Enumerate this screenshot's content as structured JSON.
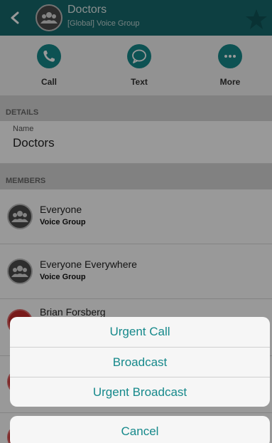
{
  "header": {
    "title": "Doctors",
    "subtitle": "[Global] Voice Group",
    "back_icon": "chevron-left-icon",
    "favorite_icon": "star-icon"
  },
  "actions": [
    {
      "label": "Call",
      "icon": "phone-icon"
    },
    {
      "label": "Text",
      "icon": "chat-bubble-icon"
    },
    {
      "label": "More",
      "icon": "ellipsis-icon"
    }
  ],
  "details": {
    "section_label": "DETAILS",
    "name_label": "Name",
    "name_value": "Doctors"
  },
  "members": {
    "section_label": "MEMBERS",
    "items": [
      {
        "name": "Everyone",
        "type": "Voice Group",
        "icon": "group-icon"
      },
      {
        "name": "Everyone Everywhere",
        "type": "Voice Group",
        "icon": "group-icon"
      },
      {
        "name": "Brian Forsberg",
        "icon": "person-avatar"
      }
    ]
  },
  "action_sheet": {
    "options": [
      "Urgent Call",
      "Broadcast",
      "Urgent Broadcast"
    ],
    "cancel_label": "Cancel"
  },
  "colors": {
    "header_bg": "#166a6d",
    "accent": "#16898b",
    "section_bg": "#d7d7d7"
  }
}
